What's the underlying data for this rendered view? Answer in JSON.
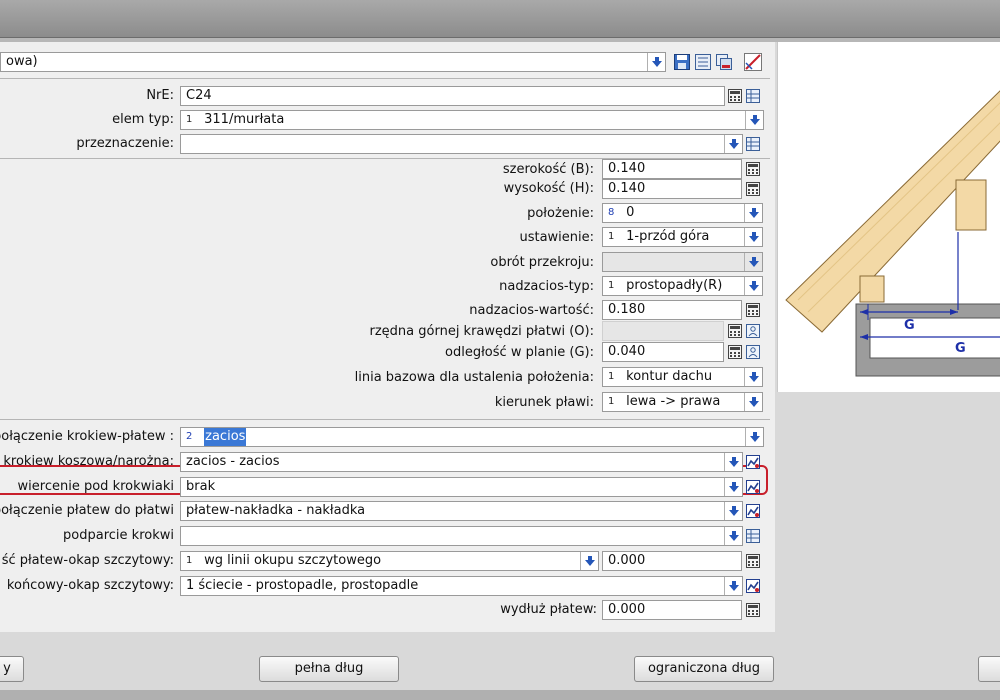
{
  "header": {
    "selector_value": "owa)"
  },
  "fields": {
    "nre": {
      "label": "NrE:",
      "value": "C24"
    },
    "elem_typ": {
      "label": "elem typ:",
      "code": "1",
      "value": "311/murłata"
    },
    "przeznaczenie": {
      "label": "przeznaczenie:",
      "value": ""
    },
    "szerokosc": {
      "label": "szerokość (B):",
      "value": "0.140"
    },
    "wysokosc": {
      "label": "wysokość (H):",
      "value": "0.140"
    },
    "polozenie": {
      "label": "położenie:",
      "code": "8",
      "value": "0"
    },
    "ustawienie": {
      "label": "ustawienie:",
      "code": "1",
      "value": "1-przód góra"
    },
    "obrot": {
      "label": "obrót przekroju:",
      "value": ""
    },
    "nadzacios_typ": {
      "label": "nadzacios-typ:",
      "code": "1",
      "value": "prostopadły(R)"
    },
    "nadzacios_wartosc": {
      "label": "nadzacios-wartość:",
      "value": "0.180"
    },
    "rzedna": {
      "label": "rzędna górnej krawędzi płatwi (O):",
      "value": ""
    },
    "odleglosc": {
      "label": "odległość w planie (G):",
      "value": "0.040"
    },
    "linia_bazowa": {
      "label": "linia bazowa dla ustalenia położenia:",
      "code": "1",
      "value": "kontur dachu"
    },
    "kierunek": {
      "label": "kierunek pławi:",
      "code": "1",
      "value": "lewa -> prawa"
    },
    "polaczenie_krokiew": {
      "label": "połączenie krokiew-płatew :",
      "code": "2",
      "value": "zacios"
    },
    "krokiew_koszowa": {
      "label": "krokiew koszowa/narożna:",
      "value": "zacios - zacios"
    },
    "wiercenie": {
      "label": "wiercenie pod krokwiaki",
      "value": "brak"
    },
    "polaczenie_platew": {
      "label": "połączenie płatew do płatwi",
      "value": "płatew-nakładka - nakładka"
    },
    "podparcie": {
      "label": "podparcie krokwi",
      "value": ""
    },
    "platew_okap": {
      "label": "ść płatew-okap szczytowy:",
      "code": "1",
      "value": "wg linii okupu szczytowego",
      "extra_value": "0.000"
    },
    "koncowy_okap": {
      "label": "końcowy-okap szczytowy:",
      "value": "1 ściecie - prostopadle, prostopadle"
    },
    "wydluz": {
      "label": "wydłuż płatew:",
      "value": "0.000"
    }
  },
  "buttons": {
    "left_partial": "y",
    "pelna": "pełna dług",
    "ograniczona": "ograniczona dług"
  },
  "drawing": {
    "dim_label_1": "G",
    "dim_label_2": "G"
  },
  "colors": {
    "accent_blue": "#1f3fb3",
    "highlight_red": "#c81f2b",
    "wood": "#f3d9a6",
    "selection": "#3a78d6"
  }
}
